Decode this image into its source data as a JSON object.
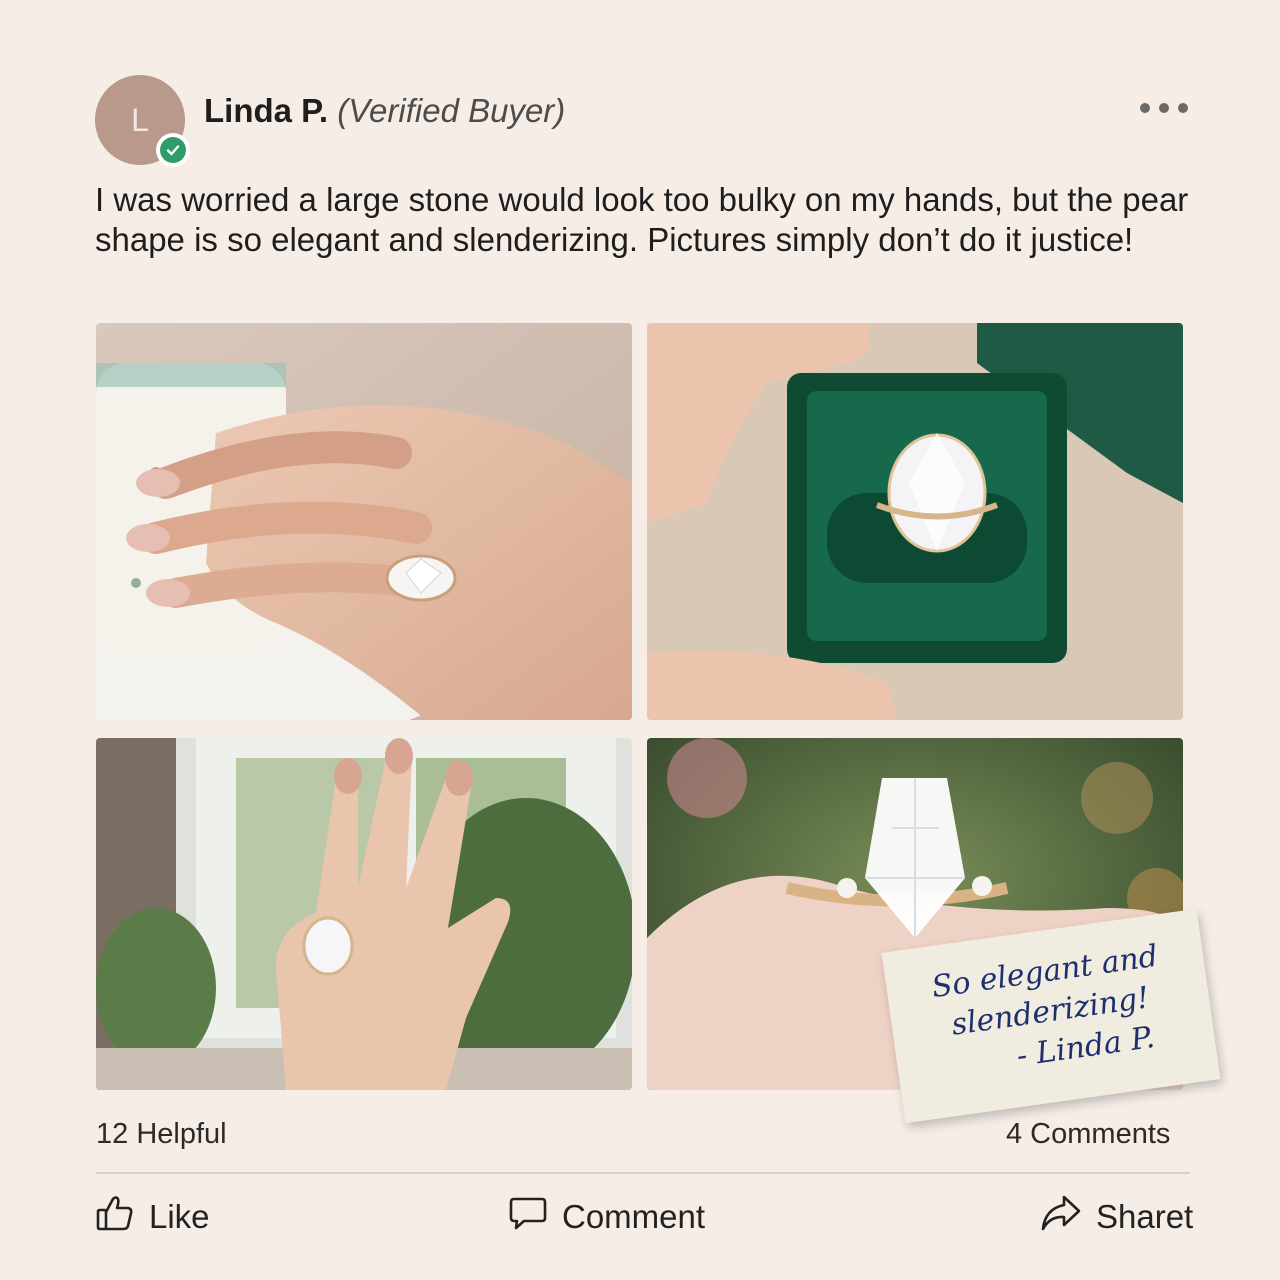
{
  "author": {
    "initial": "L",
    "name": "Linda P.",
    "tag": "(Verified Buyer)"
  },
  "review": {
    "text": "I was worried a large stone would look too bulky on my hands, but the pear shape is so elegant and slenderizing. Pictures simply don’t do it justice!"
  },
  "photos": [
    {
      "alt": "hand with pear ring holding teacup"
    },
    {
      "alt": "ring in green velvet box"
    },
    {
      "alt": "hand showing ring by window"
    },
    {
      "alt": "close-up of pear diamond ring"
    }
  ],
  "note": {
    "line1": "So elegant and",
    "line2": "slenderizing!",
    "line3": "- Linda P."
  },
  "stats": {
    "helpful": "12 Helpful",
    "comments": "4 Comments"
  },
  "actions": {
    "like": "Like",
    "comment": "Comment",
    "share": "Sharet"
  },
  "colors": {
    "background": "#f6ede7",
    "avatar": "#b8998b",
    "verified": "#2f9c6a",
    "note_ink": "#1d2f6e"
  },
  "icons": [
    "more-options-icon",
    "verified-check-icon",
    "thumbs-up-icon",
    "comment-bubble-icon",
    "share-arrow-icon"
  ]
}
